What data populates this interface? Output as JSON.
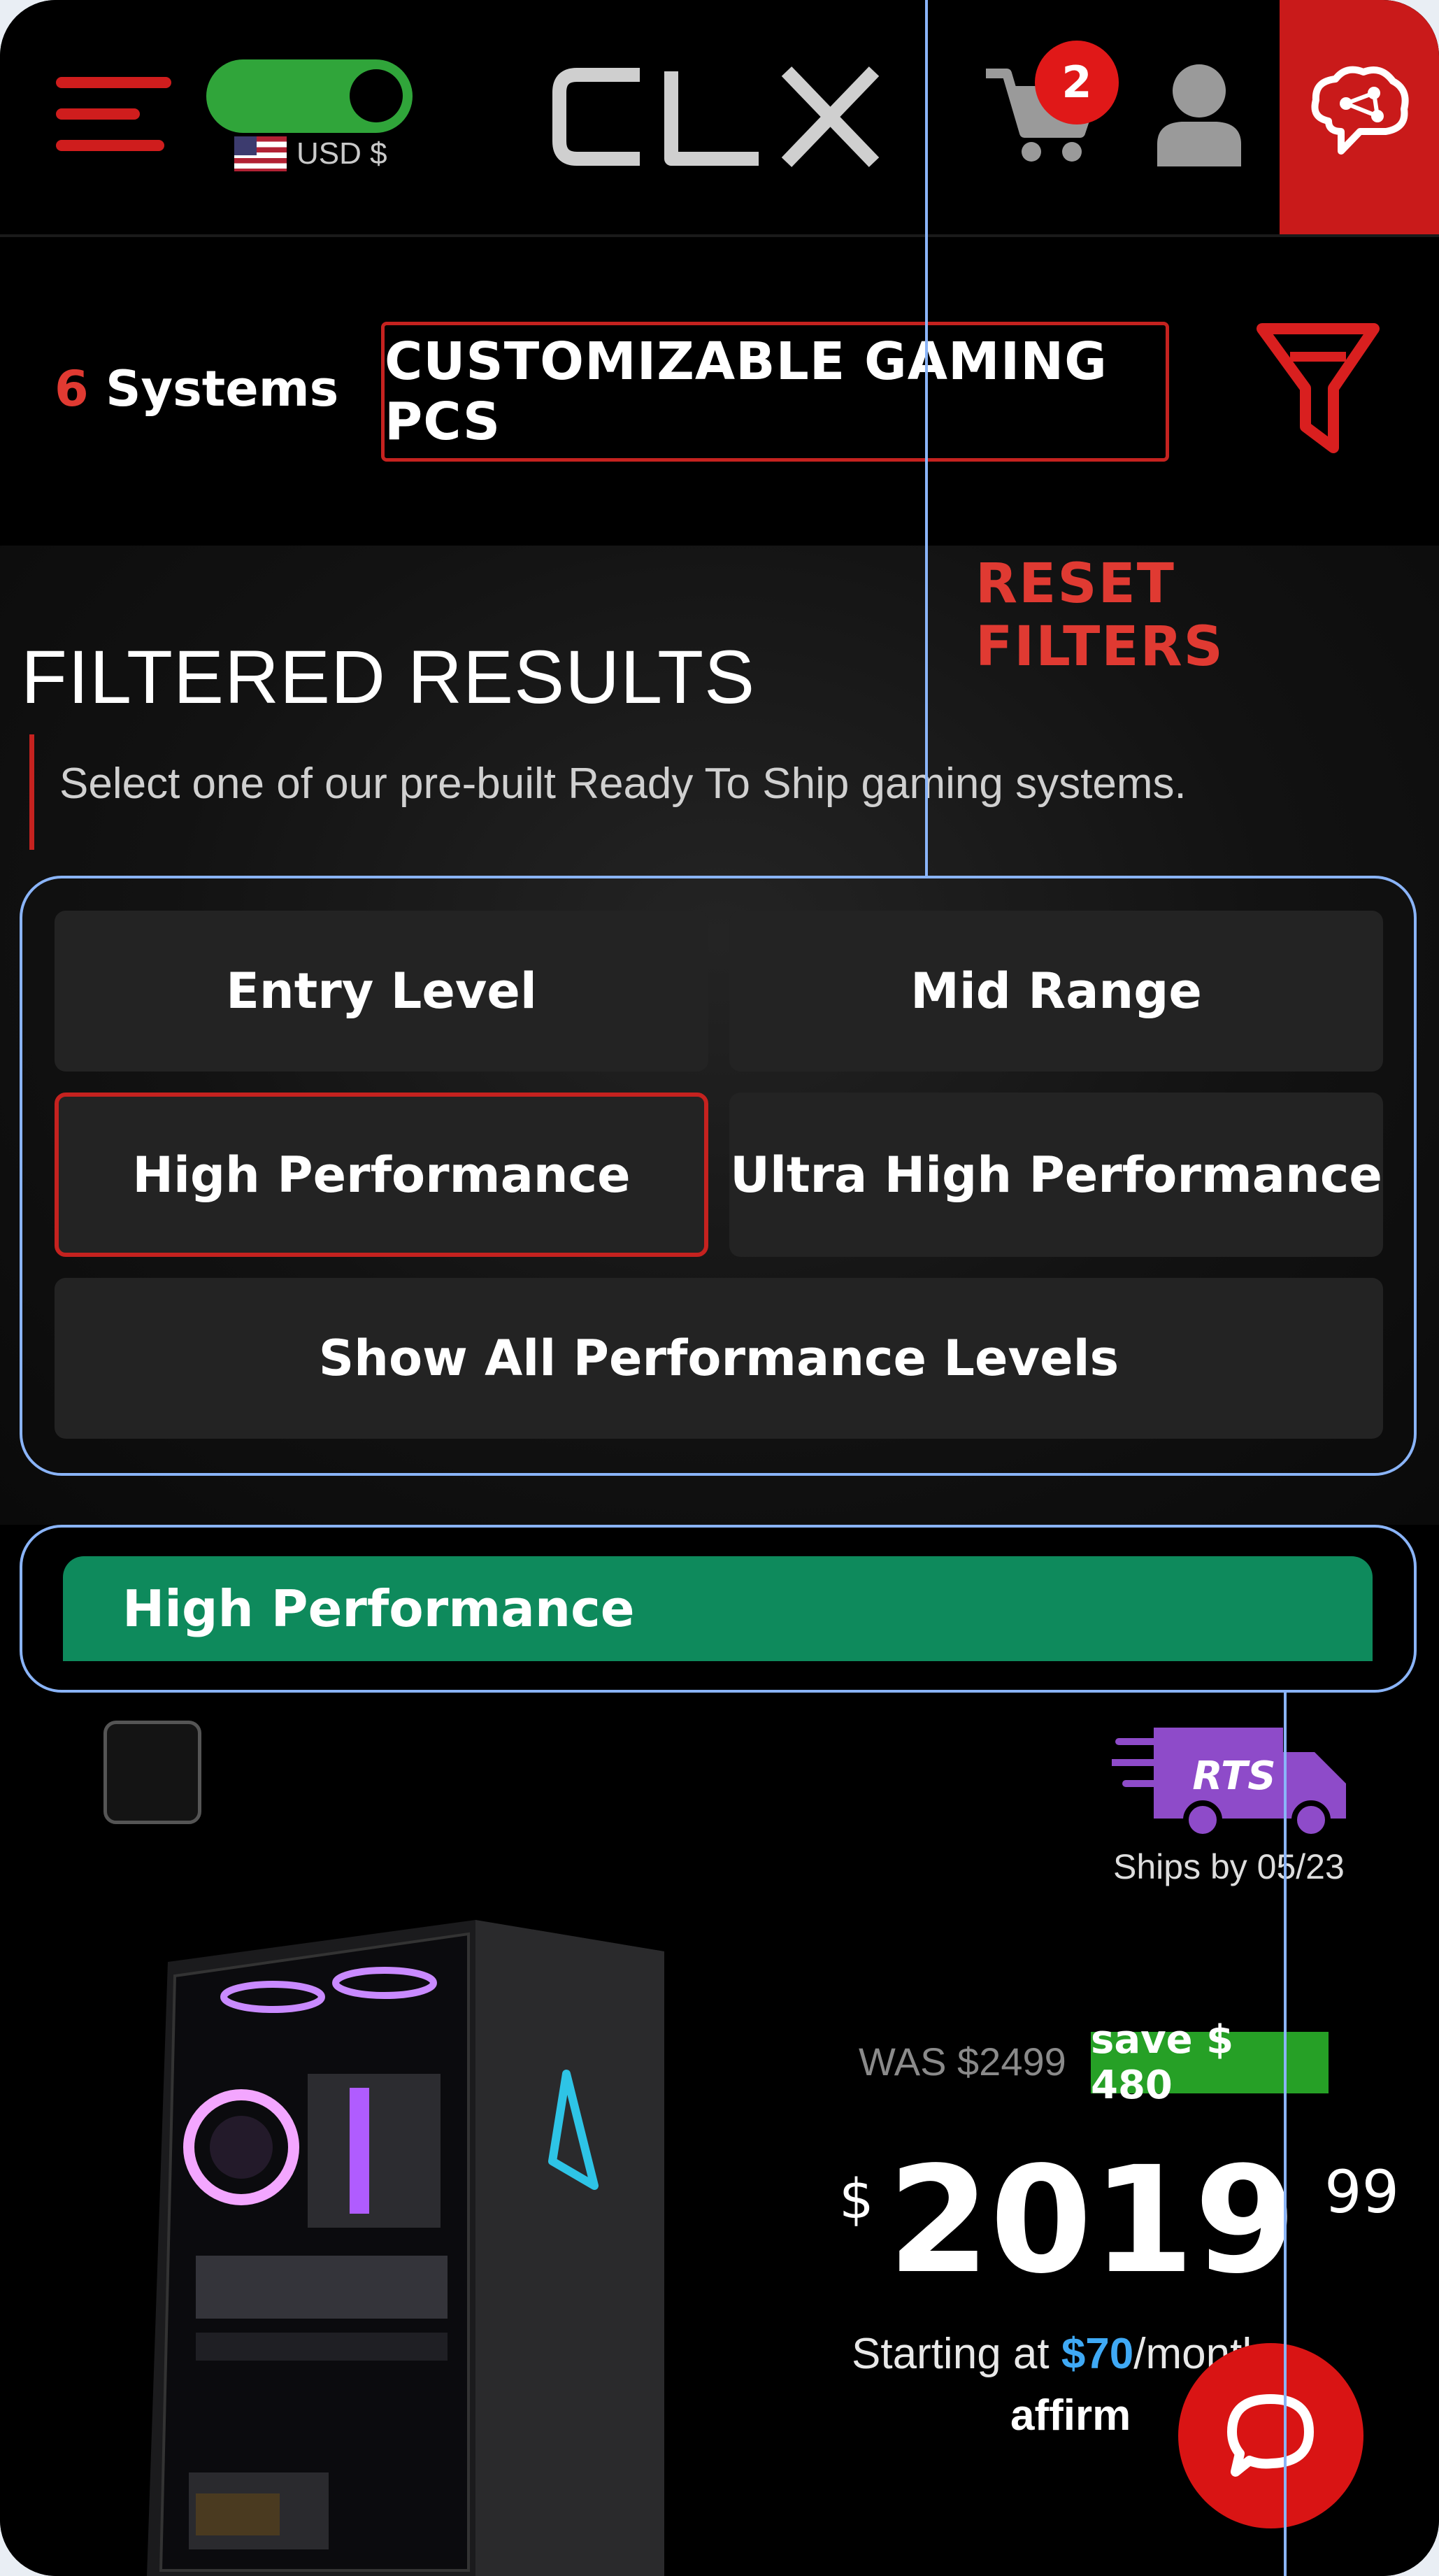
{
  "header": {
    "currency": "USD $",
    "cart_count": "2"
  },
  "filterbar": {
    "systems_count": "6",
    "systems_label": "Systems",
    "category": "CUSTOMIZABLE GAMING PCS"
  },
  "hero": {
    "reset_filters": "RESET FILTERS",
    "title": "FILTERED RESULTS",
    "subtitle": "Select one of our pre-built Ready To Ship gaming systems."
  },
  "tiers": [
    {
      "label": "Entry Level",
      "selected": false
    },
    {
      "label": "Mid Range",
      "selected": false
    },
    {
      "label": "High Performance",
      "selected": true
    },
    {
      "label": "Ultra High Performance",
      "selected": false
    },
    {
      "label": "Show All Performance Levels",
      "selected": false
    }
  ],
  "section": {
    "heading": "High Performance"
  },
  "product": {
    "rts_badge": "RTS",
    "ships_by": "Ships by 05/23",
    "was_price": "WAS $2499",
    "save": "save $ 480",
    "currency_symbol": "$",
    "price_whole": "2019",
    "price_cents": "99",
    "finance_prefix": "Starting at ",
    "finance_amount": "$70",
    "finance_suffix": "/month",
    "affirm": "affirm"
  },
  "colors": {
    "accent_red": "#c5221f",
    "section_green": "#0e8a5c",
    "save_green": "#26a026",
    "toggle_green": "#30a53a",
    "rts_purple": "#8e4bc9",
    "finance_blue": "#3fa9f5"
  },
  "icons": {
    "menu": "hamburger-icon",
    "cart": "cart-icon",
    "user": "user-icon",
    "brain": "brain-icon",
    "filter": "funnel-icon",
    "chat": "chat-icon",
    "truck": "delivery-truck-icon"
  }
}
